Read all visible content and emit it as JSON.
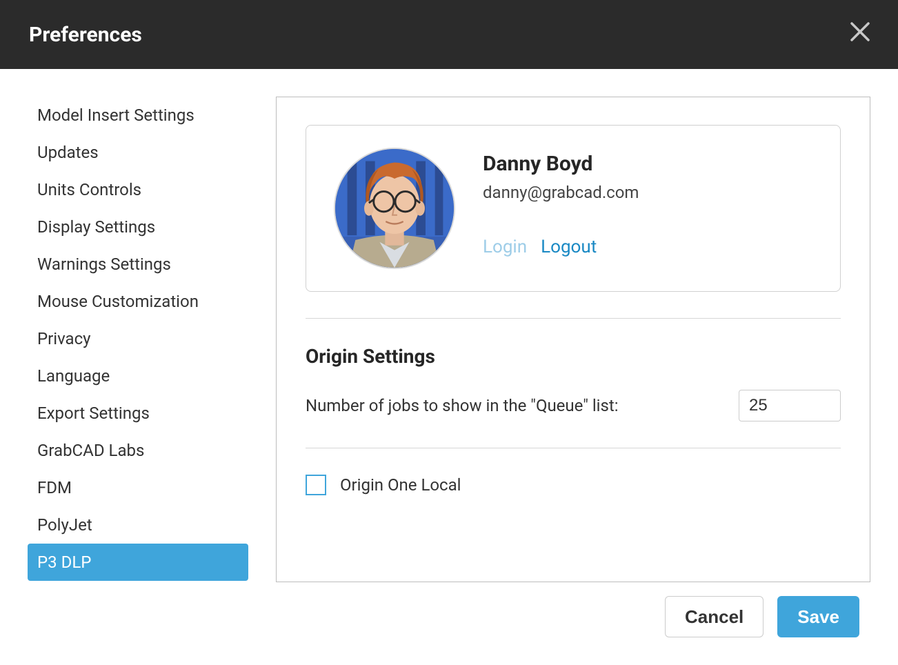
{
  "dialog": {
    "title": "Preferences"
  },
  "sidebar": {
    "items": [
      {
        "label": "Model Insert Settings"
      },
      {
        "label": "Updates"
      },
      {
        "label": "Units Controls"
      },
      {
        "label": "Display Settings"
      },
      {
        "label": "Warnings Settings"
      },
      {
        "label": "Mouse Customization"
      },
      {
        "label": "Privacy"
      },
      {
        "label": "Language"
      },
      {
        "label": "Export Settings"
      },
      {
        "label": "GrabCAD Labs"
      },
      {
        "label": "FDM"
      },
      {
        "label": "PolyJet"
      },
      {
        "label": "P3 DLP"
      }
    ],
    "activeIndex": 12
  },
  "account": {
    "name": "Danny Boyd",
    "email": "danny@grabcad.com",
    "loginLabel": "Login",
    "logoutLabel": "Logout"
  },
  "origin": {
    "sectionTitle": "Origin Settings",
    "jobsLabel": "Number of jobs to show in the \"Queue\" list:",
    "jobsValue": "25",
    "localLabel": "Origin One Local",
    "localChecked": false
  },
  "footer": {
    "cancel": "Cancel",
    "save": "Save"
  }
}
